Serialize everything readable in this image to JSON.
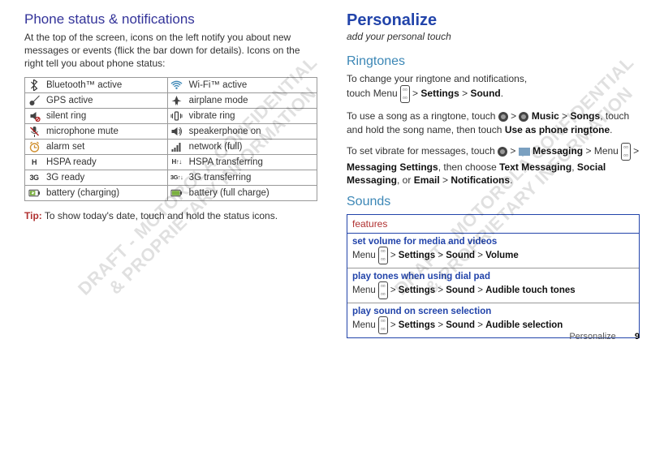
{
  "left": {
    "heading": "Phone status & notifications",
    "intro": "At the top of the screen, icons on the left notify you about new messages or events (flick the bar down for details). Icons on the right tell you about phone status:",
    "rows": [
      {
        "a": "Bluetooth™ active",
        "b": "Wi-Fi™ active"
      },
      {
        "a": "GPS active",
        "b": "airplane mode"
      },
      {
        "a": "silent ring",
        "b": "vibrate ring"
      },
      {
        "a": "microphone mute",
        "b": "speakerphone on"
      },
      {
        "a": "alarm set",
        "b": "network (full)"
      },
      {
        "a": "HSPA ready",
        "aBadge": "H",
        "b": "HSPA transferring",
        "bBadge": "H↑↓"
      },
      {
        "a": "3G ready",
        "aBadge": "3G",
        "b": "3G transferring",
        "bBadge": "3G↑↓"
      },
      {
        "a": "battery (charging)",
        "b": "battery (full charge)"
      }
    ],
    "tipLabel": "Tip:",
    "tipBody": " To show today's date, touch and hold the status icons."
  },
  "right": {
    "heading": "Personalize",
    "sub": "add your personal touch",
    "ringHead": "Ringtones",
    "ring1a": "To change your ringtone and notifications,",
    "ring1b": "touch Menu ",
    "ring1c": " > ",
    "ring1Settings": "Settings",
    "ring1d": " > ",
    "ring1Sound": "Sound",
    "ring1e": ".",
    "ring2a": "To use a song as a ringtone, touch ",
    "ring2b": " > ",
    "ring2Music": " Music",
    "ring2c": " > ",
    "ring2Songs": "Songs",
    "ring2d": ", touch and hold the song name, then touch ",
    "ring2Use": "Use as phone ringtone",
    "ring2e": ".",
    "ring3a": "To set vibrate for messages, touch ",
    "ring3b": " > ",
    "ring3Msg": " Messaging",
    "ring3c": " > Menu ",
    "ring3d": " > ",
    "ring3MsgSet": "Messaging Settings",
    "ring3e": ", then choose ",
    "ring3Text": "Text Messaging",
    "ring3f": ", ",
    "ring3Soc": "Social Messaging",
    "ring3g": ", or ",
    "ring3Email": "Email",
    "ring3h": " > ",
    "ring3Notif": "Notifications",
    "ring3i": ".",
    "soundsHead": "Sounds",
    "featHead": "features",
    "features": [
      {
        "title": "set volume for media and videos",
        "bodyA": "Menu ",
        "b1": "Settings",
        "b2": "Sound",
        "b3": "Volume"
      },
      {
        "title": "play tones when using dial pad",
        "bodyA": "Menu ",
        "b1": "Settings",
        "b2": "Sound",
        "b3": "Audible touch tones"
      },
      {
        "title": "play sound on screen selection",
        "bodyA": "Menu ",
        "b1": "Settings",
        "b2": "Sound",
        "b3": "Audible selection"
      }
    ]
  },
  "footer": {
    "section": "Personalize",
    "page": "9"
  },
  "watermark": "DRAFT - MOTOROLA CONFIDENTIAL\n& PROPRIETARY INFORMATION"
}
